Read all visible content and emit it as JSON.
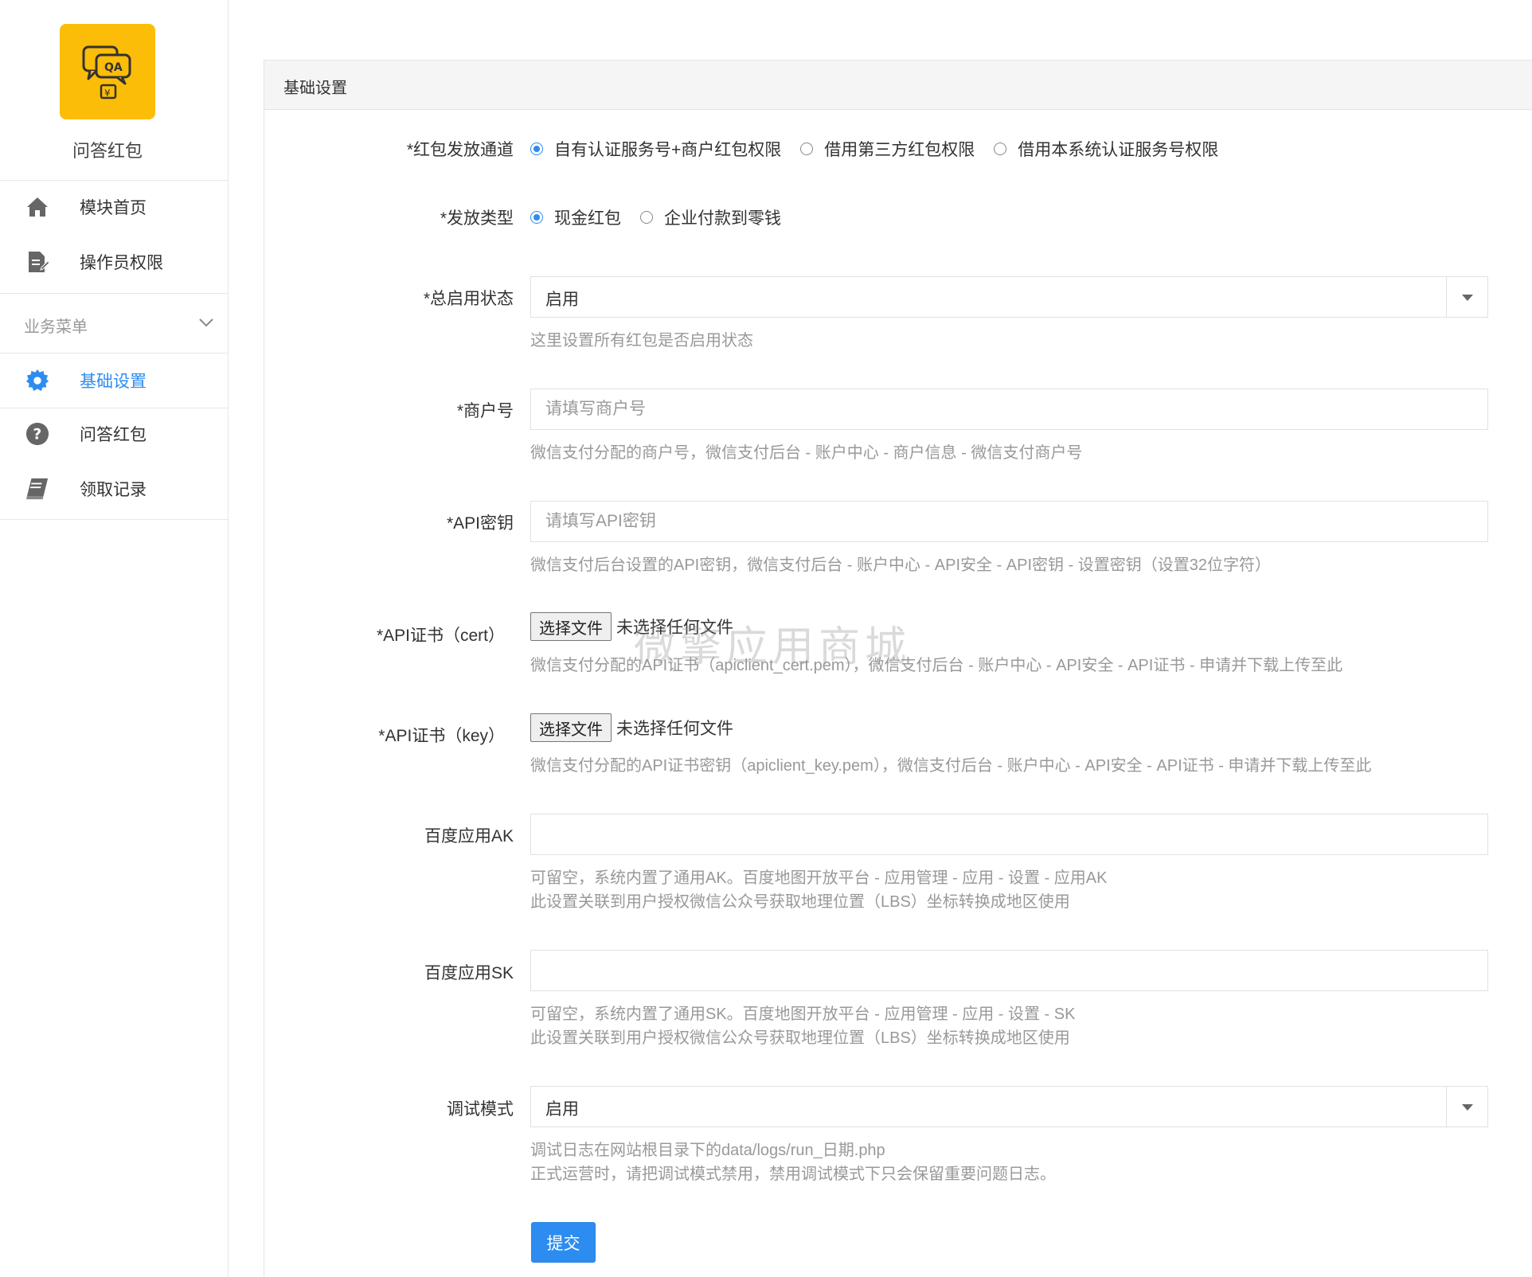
{
  "app": {
    "name": "问答红包",
    "logo_icon": "qa-redpacket-icon",
    "logo_color": "#fbbd08"
  },
  "sidebar": {
    "top_items": [
      {
        "label": "模块首页",
        "icon": "home-icon"
      },
      {
        "label": "操作员权限",
        "icon": "document-edit-icon"
      }
    ],
    "section_label": "业务菜单",
    "section_items": [
      {
        "label": "基础设置",
        "icon": "gear-icon",
        "active": true
      },
      {
        "label": "问答红包",
        "icon": "question-icon",
        "active": false
      },
      {
        "label": "领取记录",
        "icon": "book-icon",
        "active": false
      }
    ]
  },
  "panel": {
    "title": "基础设置"
  },
  "form": {
    "channel": {
      "label": "*红包发放通道",
      "options": [
        "自有认证服务号+商户红包权限",
        "借用第三方红包权限",
        "借用本系统认证服务号权限"
      ],
      "selected": 0
    },
    "send_type": {
      "label": "*发放类型",
      "options": [
        "现金红包",
        "企业付款到零钱"
      ],
      "selected": 0
    },
    "status": {
      "label": "*总启用状态",
      "value": "启用",
      "help": "这里设置所有红包是否启用状态"
    },
    "mch_id": {
      "label": "*商户号",
      "placeholder": "请填写商户号",
      "value": "",
      "help": "微信支付分配的商户号，微信支付后台 - 账户中心 - 商户信息 - 微信支付商户号"
    },
    "api_key": {
      "label": "*API密钥",
      "placeholder": "请填写API密钥",
      "value": "",
      "help": "微信支付后台设置的API密钥，微信支付后台 - 账户中心 - API安全 - API密钥 - 设置密钥（设置32位字符）"
    },
    "cert": {
      "label": "*API证书（cert）",
      "button": "选择文件",
      "status": "未选择任何文件",
      "help": "微信支付分配的API证书（apiclient_cert.pem），微信支付后台 - 账户中心 - API安全 - API证书 - 申请并下载上传至此"
    },
    "key": {
      "label": "*API证书（key）",
      "button": "选择文件",
      "status": "未选择任何文件",
      "help": "微信支付分配的API证书密钥（apiclient_key.pem），微信支付后台 - 账户中心 - API安全 - API证书 - 申请并下载上传至此"
    },
    "baidu_ak": {
      "label": "百度应用AK",
      "value": "",
      "help1": "可留空，系统内置了通用AK。百度地图开放平台 - 应用管理 - 应用 - 设置 - 应用AK",
      "help2": "此设置关联到用户授权微信公众号获取地理位置（LBS）坐标转换成地区使用"
    },
    "baidu_sk": {
      "label": "百度应用SK",
      "value": "",
      "help1": "可留空，系统内置了通用SK。百度地图开放平台 - 应用管理 - 应用 - 设置 - SK",
      "help2": "此设置关联到用户授权微信公众号获取地理位置（LBS）坐标转换成地区使用"
    },
    "debug": {
      "label": "调试模式",
      "value": "启用",
      "help1": "调试日志在网站根目录下的data/logs/run_日期.php",
      "help2": "正式运营时，请把调试模式禁用，禁用调试模式下只会保留重要问题日志。"
    },
    "submit_label": "提交"
  },
  "watermark": "微擎应用商城",
  "colors": {
    "accent": "#2d8cf0",
    "help_text": "#999999"
  }
}
